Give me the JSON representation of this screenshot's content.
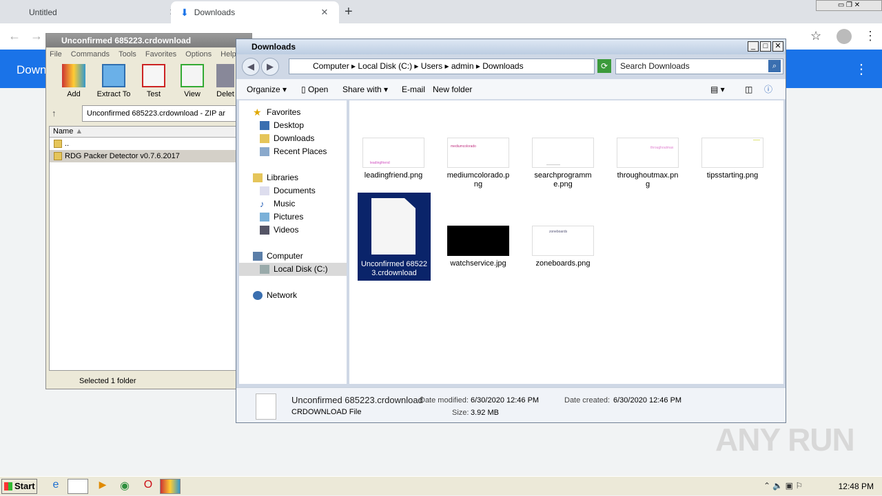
{
  "browser": {
    "tabs": [
      {
        "label": "Untitled"
      },
      {
        "label": "Downloads"
      }
    ],
    "downloads_title": "Downl"
  },
  "winrar": {
    "title": "Unconfirmed 685223.crdownload",
    "menu": [
      "File",
      "Commands",
      "Tools",
      "Favorites",
      "Options",
      "Help"
    ],
    "toolbar": [
      "Add",
      "Extract To",
      "Test",
      "View",
      "Delet"
    ],
    "address": "Unconfirmed 685223.crdownload - ZIP ar",
    "column_name": "Name",
    "rows": [
      "..",
      "RDG Packer Detector v0.7.6.2017"
    ],
    "status": "Selected 1 folder"
  },
  "explorer": {
    "title": "Downloads",
    "breadcrumb": [
      "Computer",
      "Local Disk (C:)",
      "Users",
      "admin",
      "Downloads"
    ],
    "search_placeholder": "Search Downloads",
    "commands": {
      "organize": "Organize",
      "open": "Open",
      "share": "Share with",
      "email": "E-mail",
      "new_folder": "New folder"
    },
    "nav": {
      "favorites": "Favorites",
      "desktop": "Desktop",
      "downloads": "Downloads",
      "recent": "Recent Places",
      "libraries": "Libraries",
      "documents": "Documents",
      "music": "Music",
      "pictures": "Pictures",
      "videos": "Videos",
      "computer": "Computer",
      "localdisk": "Local Disk (C:)",
      "network": "Network"
    },
    "files": [
      {
        "name": "leadingfriend.png",
        "thumb_text": "leadingfriend"
      },
      {
        "name": "mediumcolorado.png",
        "thumb_text": "mediumcolorado"
      },
      {
        "name": "searchprogramme.png",
        "thumb_text": ""
      },
      {
        "name": "throughoutmax.png",
        "thumb_text": "throughoutmax"
      },
      {
        "name": "tipsstarting.png",
        "thumb_text": ""
      },
      {
        "name": "Unconfirmed 685223.crdownload",
        "thumb_text": ""
      },
      {
        "name": "watchservice.jpg",
        "thumb_text": ""
      },
      {
        "name": "zoneboards.png",
        "thumb_text": "zoneboards"
      }
    ],
    "details": {
      "name": "Unconfirmed 685223.crdownload",
      "type": "CRDOWNLOAD File",
      "modified_label": "Date modified:",
      "modified": "6/30/2020 12:46 PM",
      "created_label": "Date created:",
      "created": "6/30/2020 12:46 PM",
      "size_label": "Size:",
      "size": "3.92 MB"
    }
  },
  "watermark": "ANY RUN",
  "taskbar": {
    "start": "Start",
    "clock": "12:48 PM"
  }
}
